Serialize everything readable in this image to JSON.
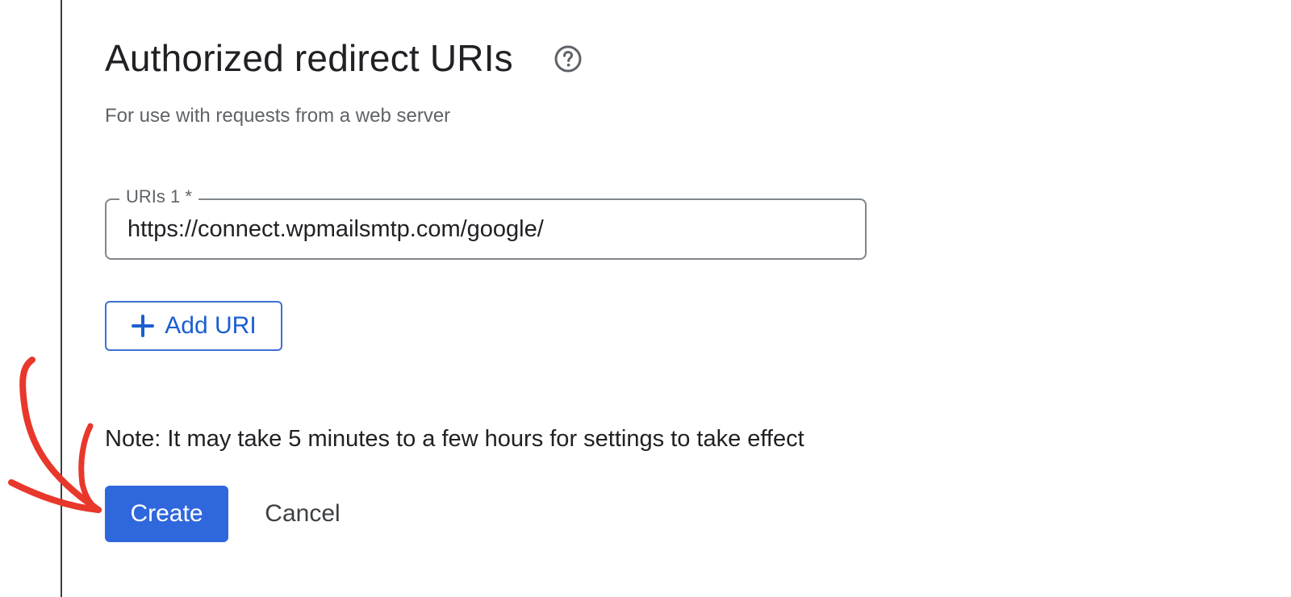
{
  "section": {
    "title": "Authorized redirect URIs",
    "help_icon": "help-circle-icon",
    "subtitle": "For use with requests from a web server"
  },
  "uri_field": {
    "label": "URIs 1 *",
    "value": "https://connect.wpmailsmtp.com/google/"
  },
  "add_uri_button": {
    "icon": "plus-icon",
    "label": "Add URI"
  },
  "note": "Note: It may take 5 minutes to a few hours for settings to take effect",
  "actions": {
    "create_label": "Create",
    "cancel_label": "Cancel"
  },
  "colors": {
    "primary": "#2f67dc",
    "link_blue": "#1a5fd0",
    "annotation_red": "#e8372b",
    "text": "#202124",
    "secondary_text": "#5f6368"
  }
}
